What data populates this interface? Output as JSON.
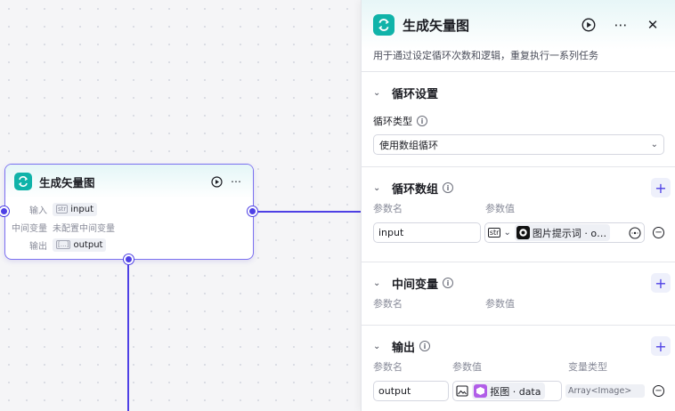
{
  "node": {
    "title": "生成矢量图",
    "input_label": "输入",
    "input_type": "str",
    "input_value": "input",
    "intermediate_label": "中间变量",
    "intermediate_value": "未配置中间变量",
    "output_label": "输出",
    "output_value": "output"
  },
  "panel": {
    "title": "生成矢量图",
    "description": "用于通过设定循环次数和逻辑，重复执行一系列任务",
    "loop_settings": {
      "title": "循环设置",
      "type_label": "循环类型",
      "type_value": "使用数组循环"
    },
    "loop_array": {
      "title": "循环数组",
      "col_name": "参数名",
      "col_value": "参数值",
      "param_name": "input",
      "param_type": "str",
      "param_ref": "图片提示词 · o…"
    },
    "intermediate": {
      "title": "中间变量",
      "col_name": "参数名",
      "col_value": "参数值"
    },
    "output": {
      "title": "输出",
      "col_name": "参数名",
      "col_value": "参数值",
      "col_type": "变量类型",
      "param_name": "output",
      "param_ref": "抠图 · data",
      "param_type": "Array<Image>"
    }
  },
  "colors": {
    "accent": "#4e40e5",
    "brand_teal": "#10b3a9"
  }
}
